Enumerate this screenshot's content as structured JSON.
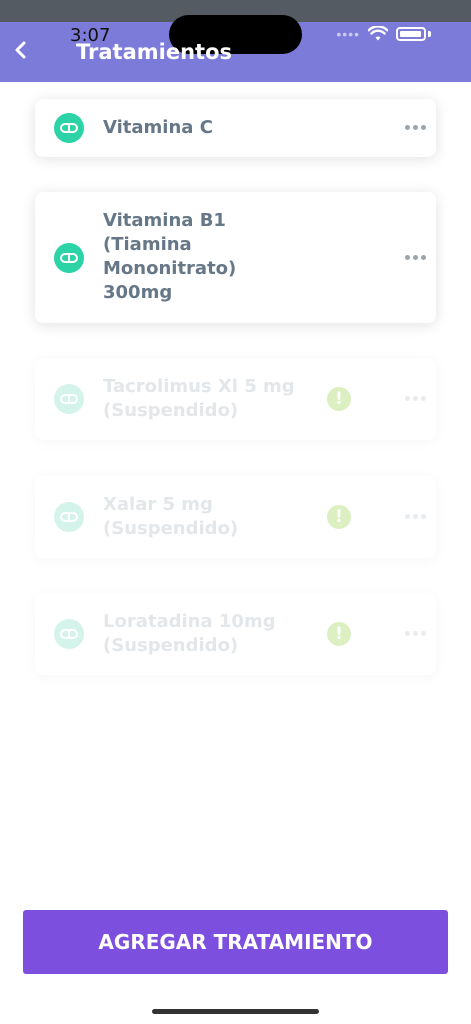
{
  "status_bar": {
    "time": "3:07",
    "icons": [
      "signal-dots-icon",
      "wifi-icon",
      "battery-icon"
    ]
  },
  "header": {
    "title": "Tratamientos",
    "back_icon": "chevron-left-icon"
  },
  "treatments": [
    {
      "name": "Vitamina C",
      "suspended": false,
      "icon": "pill-icon"
    },
    {
      "name": "Vitamina B1 (Tiamina Mononitrato) 300mg",
      "lines": [
        "Vitamina B1",
        "(Tiamina",
        "Mononitrato)",
        "300mg"
      ],
      "suspended": false,
      "icon": "pill-icon"
    },
    {
      "name": "Tacrolimus Xl 5 mg (Suspendido)",
      "lines": [
        "Tacrolimus Xl 5 mg",
        "(Suspendido)"
      ],
      "suspended": true,
      "icon": "pill-icon",
      "warning_icon": "exclamation-icon"
    },
    {
      "name": "Xalar 5 mg (Suspendido)",
      "lines": [
        "Xalar 5 mg",
        "(Suspendido)"
      ],
      "suspended": true,
      "icon": "pill-icon",
      "warning_icon": "exclamation-icon"
    },
    {
      "name": "Loratadina 10mg (Suspendido)",
      "lines": [
        "Loratadina 10mg",
        "(Suspendido)"
      ],
      "suspended": true,
      "icon": "pill-icon",
      "warning_icon": "exclamation-icon"
    }
  ],
  "footer": {
    "add_label": "AGREGAR TRATAMIENTO"
  },
  "colors": {
    "header": "#7c7bd9",
    "accent_button": "#7c4fde",
    "pill": "#2cd3a7",
    "text": "#667788"
  }
}
